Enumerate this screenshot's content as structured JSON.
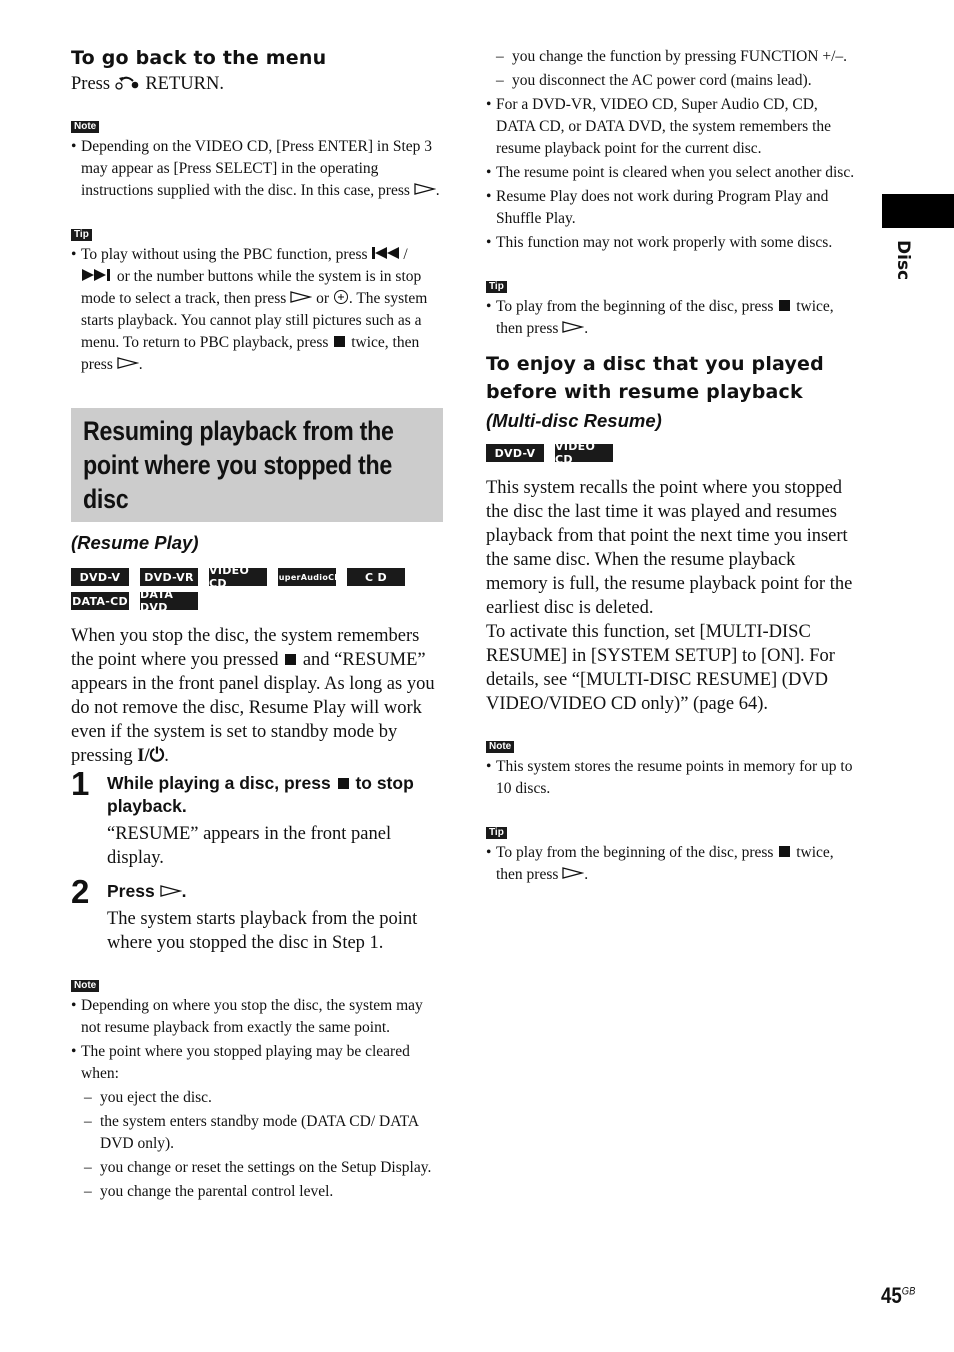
{
  "left": {
    "back_heading": "To go back to the menu",
    "back_press": "Press",
    "back_return": "RETURN.",
    "note1": {
      "label": "Note",
      "items": [
        "Depending on the VIDEO CD, [Press ENTER] in Step 3 may appear as [Press SELECT] in the operating instructions supplied with the disc. In this case, press"
      ]
    },
    "tip1": {
      "label": "Tip",
      "part1": "To play without using the PBC function, press",
      "part2": "or the number buttons while the system is in stop mode to select a track, then press",
      "part3": "or",
      "part4": ". The system starts playback. You cannot play still pictures such as a menu. To return to PBC playback, press",
      "part5": "twice, then press"
    },
    "banner_title": "Resuming playback from the point where you stopped the disc",
    "banner_subtitle": "(Resume Play)",
    "badges": [
      "DVD-V",
      "DVD-VR",
      "VIDEO CD",
      "SuperAudioCD",
      "C D",
      "DATA-CD",
      "DATA DVD"
    ],
    "intro_a": "When you stop the disc, the system remembers the point where you pressed",
    "intro_b": "and “RESUME” appears in the front panel display. As long as you do not remove the disc, Resume Play will work even if the system is set to standby mode by pressing",
    "steps": [
      {
        "num": "1",
        "title_a": "While playing a disc, press",
        "title_b": "to stop playback.",
        "desc": "“RESUME” appears in the front panel display."
      },
      {
        "num": "2",
        "title_a": "Press",
        "title_b": ".",
        "desc": "The system starts playback from the point where you stopped the disc in Step 1."
      }
    ],
    "note2": {
      "label": "Note",
      "item1": "Depending on where you stop the disc, the system may not resume playback from exactly the same point.",
      "item2": "The point where you stopped playing may be cleared when:",
      "dashes": [
        "you eject the disc.",
        "the system enters standby mode (DATA CD/ DATA DVD only).",
        "you change or reset the settings on the Setup Display.",
        "you change the parental control level."
      ]
    }
  },
  "right": {
    "dashes": [
      "you change the function by pressing FUNCTION +/–.",
      "you disconnect the AC power cord (mains lead)."
    ],
    "bullets": [
      "For a DVD-VR, VIDEO CD, Super Audio CD, CD, DATA CD, or DATA DVD, the system remembers the resume playback point for the current disc.",
      "The resume point is cleared when you select another disc.",
      "Resume Play does not work during Program Play and Shuffle Play.",
      "This function may not work properly with some discs."
    ],
    "tip1": {
      "label": "Tip",
      "part1": "To play from the beginning of the disc, press",
      "part2": "twice, then press"
    },
    "heading": "To enjoy a disc that you played before with resume playback",
    "subtitle": "(Multi-disc Resume)",
    "badges": [
      "DVD-V",
      "VIDEO CD"
    ],
    "para1": "This system recalls the point where you stopped the disc the last time it was played and resumes playback from that point the next time you insert the same disc. When the resume playback memory is full, the resume playback point for the earliest disc is deleted.",
    "para2": "To activate this function, set [MULTI-DISC RESUME] in [SYSTEM SETUP] to [ON]. For details, see “[MULTI-DISC RESUME] (DVD VIDEO/VIDEO CD only)” (page 64).",
    "note": {
      "label": "Note",
      "item": "This system stores the resume points in memory for up to 10 discs."
    },
    "tip2": {
      "label": "Tip",
      "part1": "To play from the beginning of the disc, press",
      "part2": "twice, then press"
    }
  },
  "side_tab": "Disc",
  "page_number": "45",
  "page_suffix": "GB"
}
